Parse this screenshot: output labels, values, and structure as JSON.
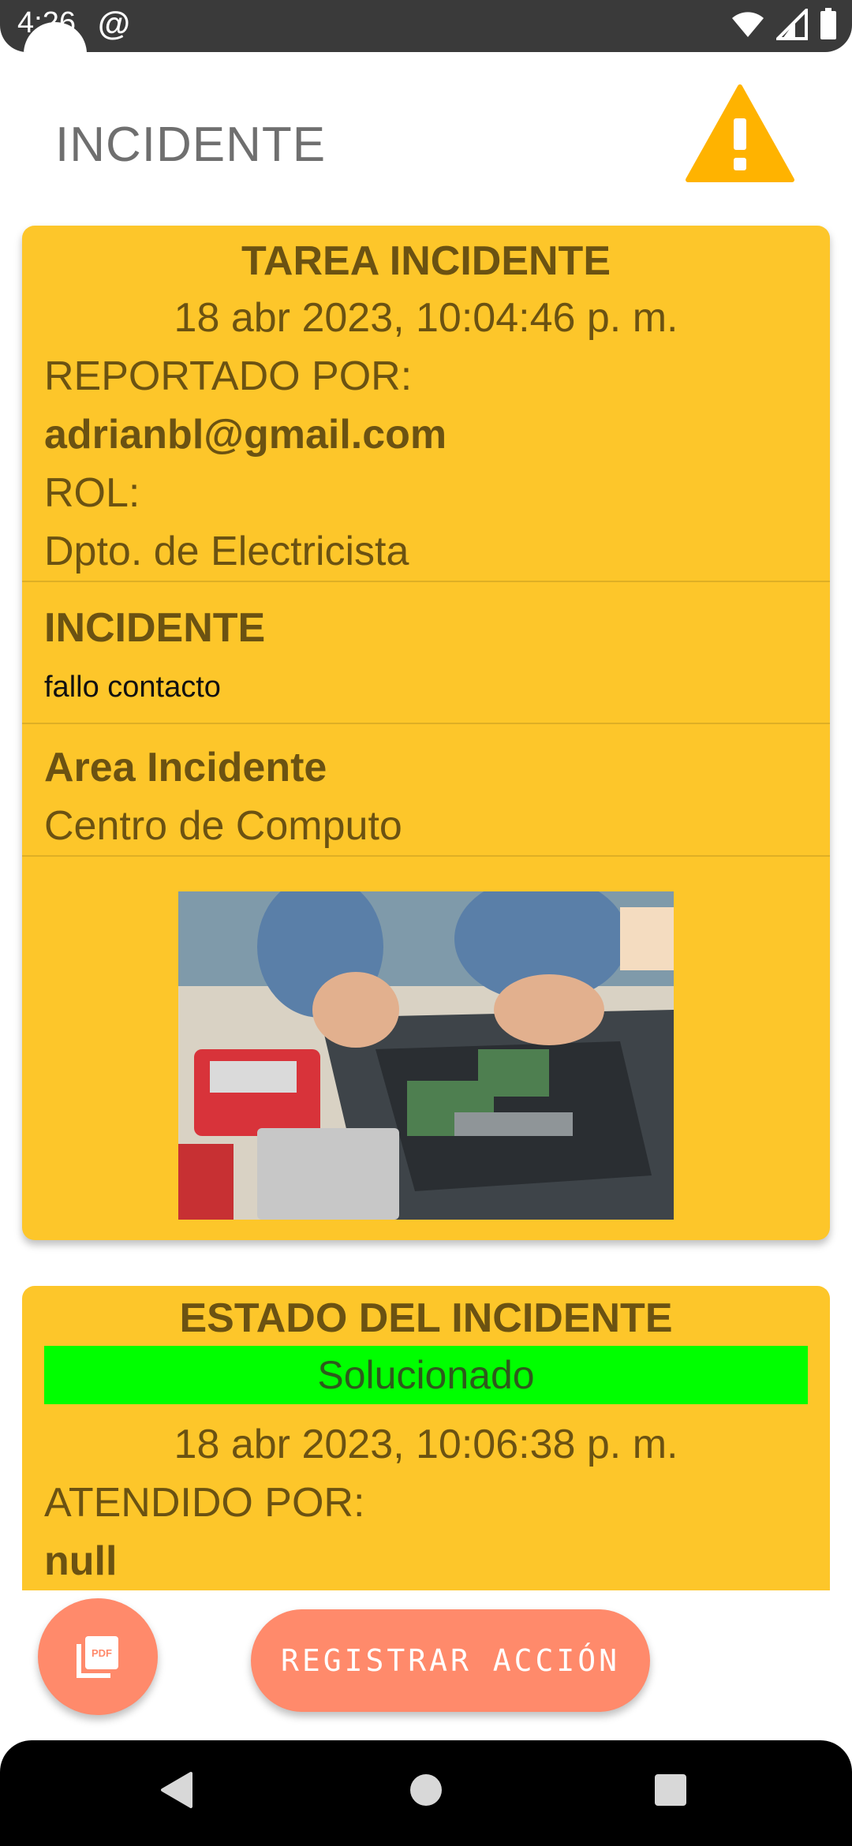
{
  "status_bar": {
    "time": "4:26"
  },
  "app_bar": {
    "title": "INCIDENTE",
    "icon": "warning-icon"
  },
  "incident_card": {
    "header": "TAREA INCIDENTE",
    "datetime": "18 abr 2023, 10:04:46 p. m.",
    "reported_by_label": "REPORTADO POR:",
    "reported_by_value": "adrianbl@gmail.com",
    "role_label": "ROL:",
    "role_value": "Dpto. de Electricista",
    "incident_label": "INCIDENTE",
    "incident_value": "fallo contacto",
    "area_label": "Area Incidente",
    "area_value": "Centro de Computo"
  },
  "status_card": {
    "header": "ESTADO DEL INCIDENTE",
    "status": "Solucionado",
    "datetime": "18 abr 2023, 10:06:38 p. m.",
    "attended_by_label": "ATENDIDO POR:",
    "attended_by_value": "null"
  },
  "actions": {
    "pdf_icon": "pdf-icon",
    "register_label": "REGISTRAR ACCIÓN"
  },
  "colors": {
    "card": "#fdc62a",
    "status_ok": "#00ff00",
    "fab": "#ff8a6b",
    "warning": "#ffb300"
  }
}
